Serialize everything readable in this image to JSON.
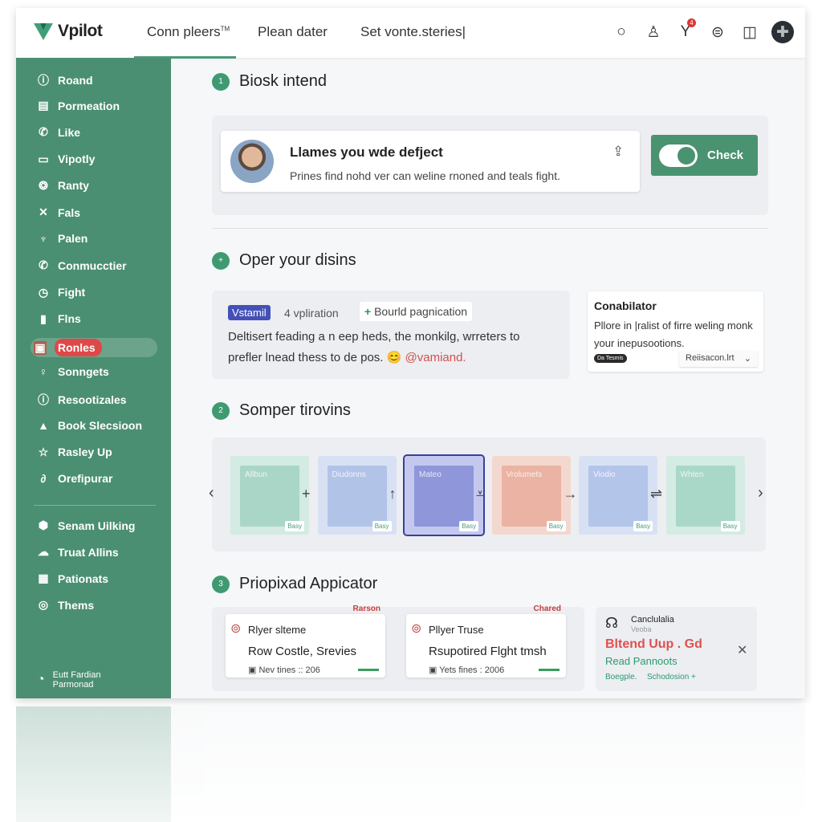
{
  "header": {
    "brand": "Vpilot",
    "nav": [
      {
        "label": "Conn pleers",
        "sup": "TM"
      },
      {
        "label": "Plean dater"
      },
      {
        "label": "Set vonte.steries|"
      }
    ],
    "icons": [
      "circle-icon",
      "user-icon",
      "filter-icon",
      "globe-icon",
      "layout-icon",
      "avatar-plus-icon"
    ],
    "notification_count": "4"
  },
  "sidebar": {
    "items": [
      {
        "label": "Roand",
        "icon": "ⓘ"
      },
      {
        "label": "Pormeation",
        "icon": "▤"
      },
      {
        "label": "Like",
        "icon": "✆"
      },
      {
        "label": "Vipotly",
        "icon": "▭"
      },
      {
        "label": "Ranty",
        "icon": "❂"
      },
      {
        "label": "Fals",
        "icon": "✕"
      },
      {
        "label": "Palen",
        "icon": "♆"
      },
      {
        "label": "Conmucctier",
        "icon": "✆"
      },
      {
        "label": "Fight",
        "icon": "◷"
      },
      {
        "label": "Flns",
        "icon": "▮"
      },
      {
        "label": "Ronles",
        "icon": "▣",
        "active": true
      },
      {
        "label": "Sonngets",
        "icon": "♀"
      },
      {
        "label": "Resootizales",
        "icon": "ⓘ"
      },
      {
        "label": "Book Slecsioon",
        "icon": "▲"
      },
      {
        "label": "Rasley Up",
        "icon": "☆"
      },
      {
        "label": "Orefipurar",
        "icon": "∂"
      }
    ],
    "items2": [
      {
        "label": "Senam Uilking",
        "icon": "⬢"
      },
      {
        "label": "Truat Allins",
        "icon": "☁"
      },
      {
        "label": "Pationats",
        "icon": "▦"
      },
      {
        "label": "Thems",
        "icon": "◎"
      }
    ],
    "footer": {
      "line1": "Eutt Fardian",
      "line2": "Parmonad"
    }
  },
  "main": {
    "s1": {
      "num": "1",
      "title": "Biosk intend",
      "card_title": "Llames you wde defject",
      "card_text": "Prines find nohd ver can weline rnoned and teals fight.",
      "check": "Check",
      "toggle_on": true
    },
    "s2": {
      "num": "+",
      "title": "Oper your disins",
      "chip": "Vstamil",
      "chip2": "4 vpliration",
      "link": "Bourld pagnication",
      "text1": "Deltisert feading a n eep heds, the monkilg, wrreters to",
      "text2": "prefler lnead thess to de pos.",
      "mention": "@vamiand.",
      "side_title": "Conabilator",
      "side_text": "Pllore in |ralist of firre weling monk your inepusootions.",
      "side_badge": "Da Tesmis",
      "side_select": "Reiisacon.lrt"
    },
    "s3": {
      "num": "2",
      "title": "Somper tirovins",
      "tiles": [
        {
          "label": "Allbun",
          "badge": "Basy",
          "color": "#a9d6c7",
          "bg": "#d3ebe2"
        },
        {
          "label": "Diudonns",
          "badge": "Basy",
          "color": "#b1c4e8",
          "bg": "#d8e1f3"
        },
        {
          "label": "Mateo",
          "badge": "Basy",
          "color": "#8f96da",
          "bg": "#c4c8ee",
          "selected": true
        },
        {
          "label": "Vrolumets",
          "badge": "Basy",
          "color": "#ebb3a3",
          "bg": "#f3d8cf"
        },
        {
          "label": "Viodio",
          "badge": "Basy",
          "color": "#b4c5ea",
          "bg": "#d8e1f4"
        },
        {
          "label": "Whten",
          "badge": "Basy",
          "color": "#aad8c8",
          "bg": "#d4ece3"
        }
      ],
      "ops": [
        "+",
        "↑",
        "⩡",
        "→",
        "⇌"
      ]
    },
    "s4": {
      "num": "3",
      "title": "Priopixad Appicator",
      "cards": [
        {
          "tag": "Rarson",
          "name": "Rlyer slteme",
          "title": "Row Costle, Srevies",
          "meta": "Nev tines :: 206"
        },
        {
          "tag": "Chared",
          "name": "Pllyer Truse",
          "title": "Rsupotired Flght tmsh",
          "meta": "Yets fines : 2006"
        }
      ],
      "promo": {
        "name": "Canclulalia",
        "sub": "Veoba",
        "title": "Bltend Uup . Gd",
        "link": "Read Pannoots",
        "foot1": "Boegple.",
        "foot2": "Schodosion +"
      }
    }
  },
  "colors": {
    "accent": "#4b8f72",
    "danger": "#e04848"
  }
}
